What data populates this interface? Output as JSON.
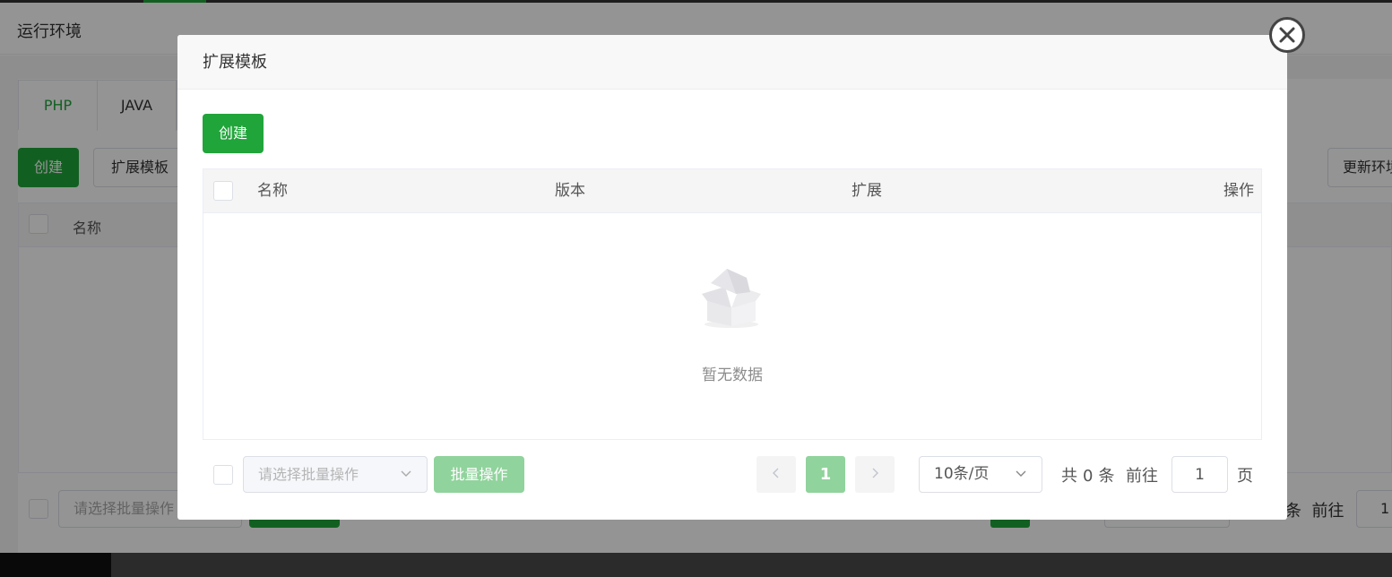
{
  "background": {
    "page_title": "运行环境",
    "tabs": [
      "PHP",
      "JAVA"
    ],
    "create_label": "创建",
    "extension_label": "扩展模板",
    "update_label": "更新环境",
    "table": {
      "col_name": "名称"
    },
    "batch_placeholder": "请选择批量操作",
    "total_tail": "条",
    "goto_label": "前往",
    "goto_value": "1"
  },
  "modal": {
    "title": "扩展模板",
    "create_label": "创建",
    "table": {
      "columns": [
        "名称",
        "版本",
        "扩展",
        "操作"
      ],
      "empty_text": "暂无数据"
    },
    "footer": {
      "batch_placeholder": "请选择批量操作",
      "batch_button": "批量操作",
      "current_page": "1",
      "page_size": "10条/页",
      "total_prefix": "共",
      "total_count": "0",
      "total_suffix": "条",
      "goto_label": "前往",
      "goto_value": "1",
      "goto_suffix": "页"
    }
  },
  "colors": {
    "primary": "#20a53a",
    "primary_disabled": "#90d39c",
    "overlay": "rgba(0,0,0,0.42)"
  },
  "icons": {
    "close": "close-icon",
    "prev": "chevron-left-icon",
    "next": "chevron-right-icon",
    "select": "chevron-down-icon",
    "empty": "empty-box-icon"
  }
}
